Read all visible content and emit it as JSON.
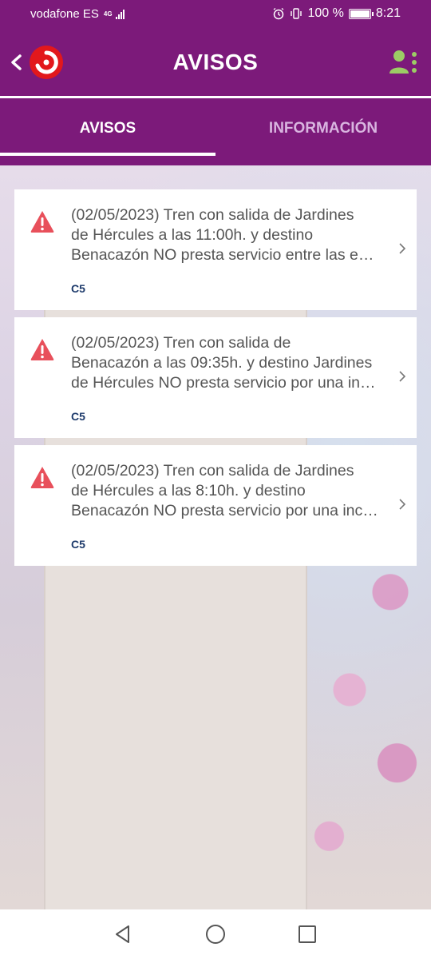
{
  "status_bar": {
    "carrier": "vodafone ES",
    "network": "4G",
    "battery": "100 %",
    "battery_level": 1.0,
    "time": "8:21"
  },
  "app_bar": {
    "title": "AVISOS",
    "back_icon": "chevron-left-icon",
    "user_icon": "user-menu-icon"
  },
  "tabs": [
    {
      "label": "AVISOS",
      "selected": true
    },
    {
      "label": "INFORMACIÓN",
      "selected": false
    }
  ],
  "notices": [
    {
      "lines": [
        "(02/05/2023) Tren con salida de Jardines",
        "de Hércules a las 11:00h. y destino",
        "Benacazón NO presta servicio entre las e…"
      ],
      "line_badge": "C5"
    },
    {
      "lines": [
        "(02/05/2023) Tren con salida de",
        "Benacazón a las 09:35h. y destino Jardines",
        "de Hércules NO presta servicio por una in…"
      ],
      "line_badge": "C5"
    },
    {
      "lines": [
        "(02/05/2023) Tren con salida de Jardines",
        "de Hércules a las 8:10h. y destino",
        "Benacazón NO presta servicio por una inc…"
      ],
      "line_badge": "C5"
    }
  ],
  "colors": {
    "primary": "#7c1a7a",
    "warning": "#e8505b",
    "badge": "#1d3a6b"
  }
}
